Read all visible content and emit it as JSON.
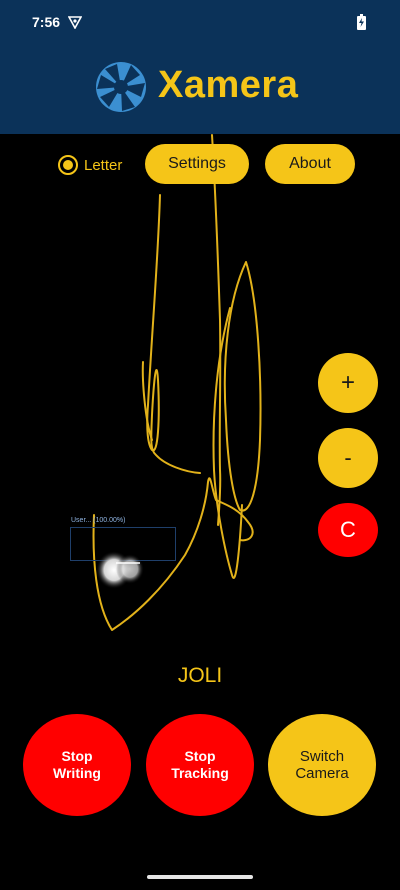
{
  "status_bar": {
    "time": "7:56",
    "vpn_icon": "vpn-key-icon",
    "battery_icon": "battery-charging-icon"
  },
  "header": {
    "title": "Xamera",
    "logo_icon": "camera-aperture-icon"
  },
  "controls": {
    "mode_radio_label": "Letter",
    "mode_radio_selected": true,
    "settings_label": "Settings",
    "about_label": "About",
    "zoom_in_label": "+",
    "zoom_out_label": "-",
    "clear_label": "C"
  },
  "detection": {
    "label": "User...    (100.00%)"
  },
  "recognized_text": "JOLI",
  "actions": {
    "stop_writing_line1": "Stop",
    "stop_writing_line2": "Writing",
    "stop_tracking_line1": "Stop",
    "stop_tracking_line2": "Tracking",
    "switch_camera_line1": "Switch",
    "switch_camera_line2": "Camera"
  },
  "colors": {
    "brand_navy": "#0b3259",
    "accent_yellow": "#f5c518",
    "danger_red": "#ff0000",
    "trace": "#e2b21a"
  }
}
